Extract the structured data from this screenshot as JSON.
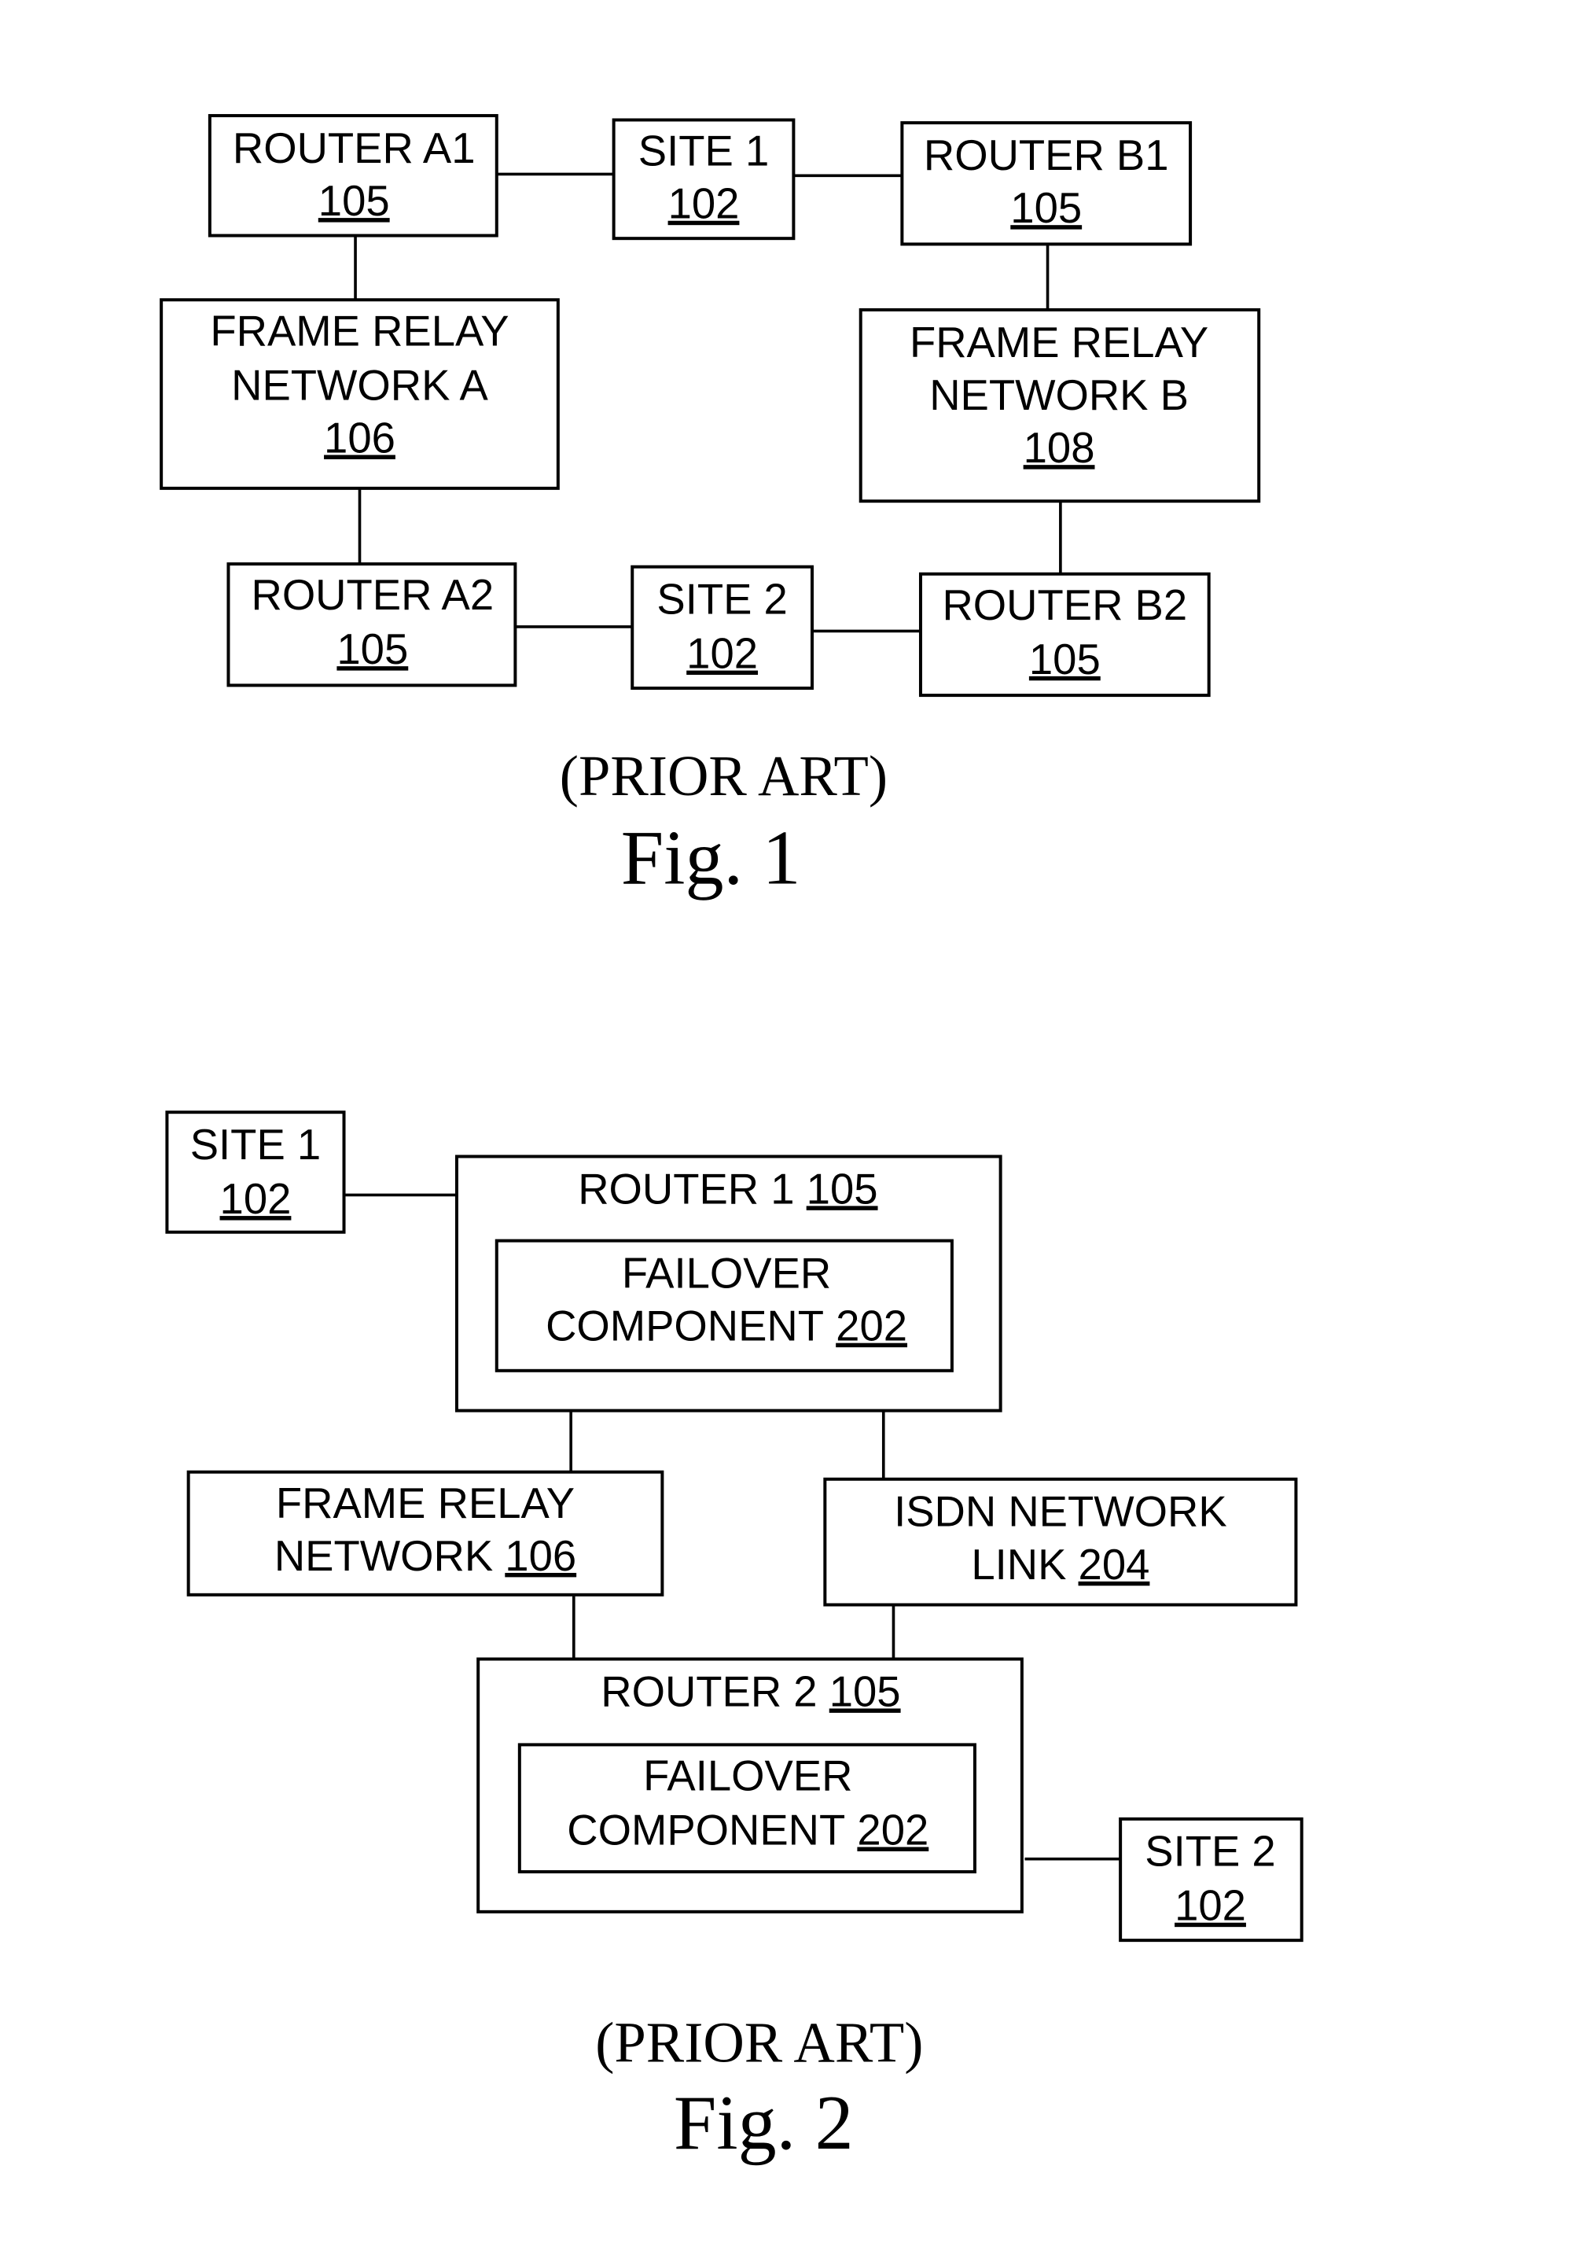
{
  "fig1": {
    "caption_note": "(PRIOR ART)",
    "caption": "Fig. 1",
    "nodes": {
      "router_a1": {
        "lines": [
          "ROUTER A1"
        ],
        "ref": "105"
      },
      "site1": {
        "lines": [
          "SITE 1"
        ],
        "ref": "102"
      },
      "router_b1": {
        "lines": [
          "ROUTER B1"
        ],
        "ref": "105"
      },
      "frnet_a": {
        "lines": [
          "FRAME RELAY",
          "NETWORK A"
        ],
        "ref": "106"
      },
      "frnet_b": {
        "lines": [
          "FRAME RELAY",
          "NETWORK B"
        ],
        "ref": "108"
      },
      "router_a2": {
        "lines": [
          "ROUTER A2"
        ],
        "ref": "105"
      },
      "site2": {
        "lines": [
          "SITE 2"
        ],
        "ref": "102"
      },
      "router_b2": {
        "lines": [
          "ROUTER B2"
        ],
        "ref": "105"
      }
    },
    "edges": [
      [
        "router_a1",
        "site1"
      ],
      [
        "site1",
        "router_b1"
      ],
      [
        "router_a1",
        "frnet_a"
      ],
      [
        "router_b1",
        "frnet_b"
      ],
      [
        "frnet_a",
        "router_a2"
      ],
      [
        "frnet_b",
        "router_b2"
      ],
      [
        "router_a2",
        "site2"
      ],
      [
        "site2",
        "router_b2"
      ]
    ]
  },
  "fig2": {
    "caption_note": "(PRIOR ART)",
    "caption": "Fig. 2",
    "nodes": {
      "site1": {
        "lines": [
          "SITE 1"
        ],
        "ref": "102"
      },
      "router1": {
        "title": "ROUTER 1",
        "ref": "105"
      },
      "failover1": {
        "lines": [
          "FAILOVER"
        ],
        "last_line": "COMPONENT",
        "ref": "202"
      },
      "frnet": {
        "lines": [
          "FRAME RELAY"
        ],
        "last_line": "NETWORK",
        "ref": "106"
      },
      "isdn": {
        "lines": [
          "ISDN NETWORK"
        ],
        "last_line": "LINK",
        "ref": "204"
      },
      "router2": {
        "title": "ROUTER 2",
        "ref": "105"
      },
      "failover2": {
        "lines": [
          "FAILOVER"
        ],
        "last_line": "COMPONENT",
        "ref": "202"
      },
      "site2": {
        "lines": [
          "SITE 2"
        ],
        "ref": "102"
      }
    },
    "edges": [
      [
        "site1",
        "router1"
      ],
      [
        "router1",
        "frnet"
      ],
      [
        "router1",
        "isdn"
      ],
      [
        "frnet",
        "router2"
      ],
      [
        "isdn",
        "router2"
      ],
      [
        "router2",
        "site2"
      ]
    ]
  }
}
